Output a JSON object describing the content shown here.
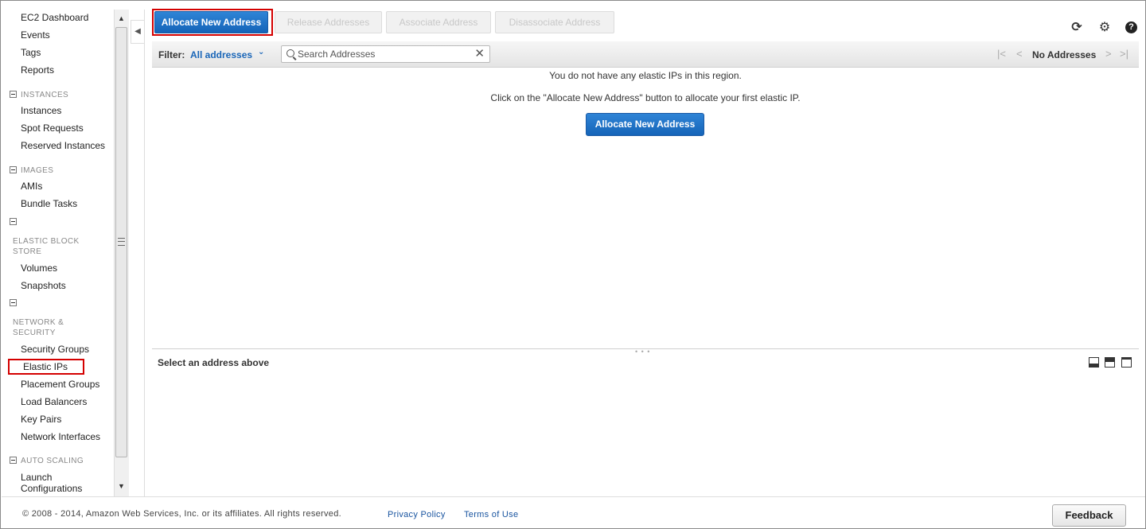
{
  "sidebar": {
    "top_items": [
      "EC2 Dashboard",
      "Events",
      "Tags",
      "Reports"
    ],
    "sections": {
      "instances": {
        "label": "INSTANCES",
        "items": [
          "Instances",
          "Spot Requests",
          "Reserved Instances"
        ]
      },
      "images": {
        "label": "IMAGES",
        "items": [
          "AMIs",
          "Bundle Tasks"
        ]
      },
      "ebs": {
        "label": "ELASTIC BLOCK STORE",
        "items": [
          "Volumes",
          "Snapshots"
        ]
      },
      "network": {
        "label": "NETWORK & SECURITY",
        "items": [
          "Security Groups",
          "Elastic IPs",
          "Placement Groups",
          "Load Balancers",
          "Key Pairs",
          "Network Interfaces"
        ]
      },
      "autoscaling": {
        "label": "AUTO SCALING",
        "items": [
          "Launch Configurations"
        ]
      }
    },
    "active_item": "Elastic IPs"
  },
  "toolbar": {
    "allocate_label": "Allocate New Address",
    "release_label": "Release Addresses",
    "associate_label": "Associate Address",
    "disassociate_label": "Disassociate Address"
  },
  "filter": {
    "label": "Filter:",
    "value": "All addresses",
    "search_placeholder": "Search Addresses",
    "pager_label": "No Addresses"
  },
  "empty_state": {
    "line1": "You do not have any elastic IPs in this region.",
    "line2": "Click on the \"Allocate New Address\" button to allocate your first elastic IP.",
    "button_label": "Allocate New Address"
  },
  "detail": {
    "title": "Select an address above"
  },
  "footer": {
    "copyright": "© 2008 - 2014, Amazon Web Services, Inc. or its affiliates. All rights reserved.",
    "privacy": "Privacy Policy",
    "terms": "Terms of Use",
    "feedback": "Feedback"
  },
  "colors": {
    "primary": "#1a66b8",
    "highlight": "#d40000"
  },
  "icons": [
    "refresh-icon",
    "gear-icon",
    "help-icon",
    "search-icon",
    "close-icon",
    "first-page-icon",
    "prev-page-icon",
    "next-page-icon",
    "last-page-icon"
  ]
}
